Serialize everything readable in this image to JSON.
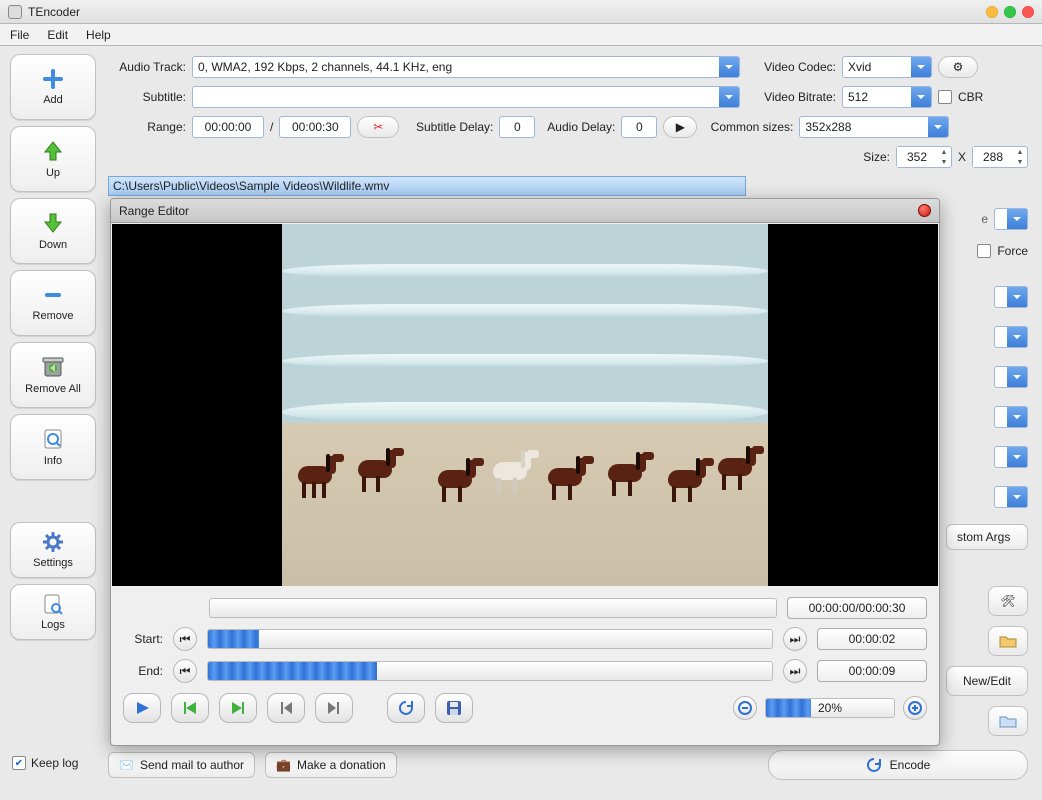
{
  "window": {
    "title": "TEncoder"
  },
  "menu": {
    "file": "File",
    "edit": "Edit",
    "help": "Help"
  },
  "sidebar": {
    "add": "Add",
    "up": "Up",
    "down": "Down",
    "remove": "Remove",
    "remove_all": "Remove All",
    "info": "Info",
    "settings": "Settings",
    "logs": "Logs"
  },
  "form": {
    "audio_track_label": "Audio Track:",
    "audio_track_value": "0, WMA2, 192 Kbps, 2 channels, 44.1 KHz, eng",
    "subtitle_label": "Subtitle:",
    "subtitle_value": "",
    "range_label": "Range:",
    "range_start": "00:00:00",
    "range_sep": "/",
    "range_end": "00:00:30",
    "subtitle_delay_label": "Subtitle Delay:",
    "subtitle_delay_value": "0",
    "audio_delay_label": "Audio Delay:",
    "audio_delay_value": "0"
  },
  "right": {
    "video_codec_label": "Video Codec:",
    "video_codec_value": "Xvid",
    "video_bitrate_label": "Video Bitrate:",
    "video_bitrate_value": "512",
    "cbr_label": "CBR",
    "common_sizes_label": "Common sizes:",
    "common_sizes_value": "352x288",
    "size_label": "Size:",
    "size_w": "352",
    "size_x": "X",
    "size_h": "288",
    "force_label": "Force",
    "custom_args": "stom Args",
    "new_edit": "New/Edit"
  },
  "file": {
    "path": "C:\\Users\\Public\\Videos\\Sample Videos\\Wildlife.wmv"
  },
  "footer": {
    "keep_log": "Keep log",
    "send_mail": "Send mail to author",
    "donate": "Make a donation",
    "encode": "Encode"
  },
  "range_editor": {
    "title": "Range Editor",
    "pos_total": "00:00:00/00:00:30",
    "start_label": "Start:",
    "start_value": "00:00:02",
    "end_label": "End:",
    "end_value": "00:00:09",
    "zoom_value": "20%",
    "start_pct": 9,
    "end_pct": 30,
    "zoom_track_pct": 35
  }
}
